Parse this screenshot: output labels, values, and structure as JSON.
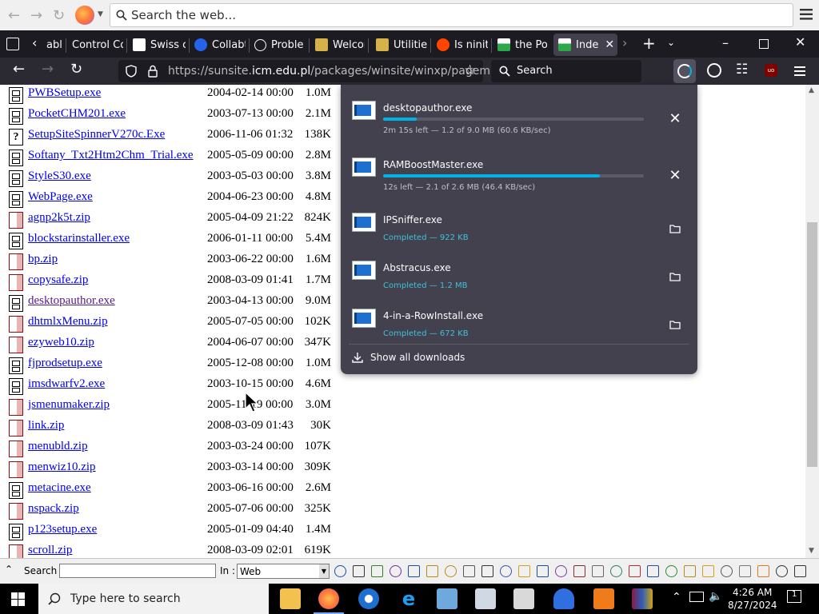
{
  "top_search": {
    "placeholder": "Search the web..."
  },
  "tabs": [
    {
      "label": "abl"
    },
    {
      "label": "Control Col"
    },
    {
      "label": "Swiss c"
    },
    {
      "label": "Collabt"
    },
    {
      "label": "Probler"
    },
    {
      "label": "Welcor"
    },
    {
      "label": "Utilitie:"
    },
    {
      "label": "Is ninite"
    },
    {
      "label": "the Pol"
    },
    {
      "label": "Inde",
      "active": true
    }
  ],
  "toolbar": {
    "url_prefix": "https://sunsite.",
    "url_domain": "icm.edu.pl",
    "url_path": "/packages/winsite/winxp/pagemkr/",
    "search_label": "Search"
  },
  "listing": [
    {
      "name": "PWBSetup.exe",
      "date": "2004-02-14 00:00",
      "size": "1.0M",
      "type": "exe"
    },
    {
      "name": "PocketCHM201.exe",
      "date": "2003-07-13 00:00",
      "size": "2.1M",
      "type": "exe"
    },
    {
      "name": "SetupSiteSpinnerV270c.Exe",
      "date": "2006-11-06 01:32",
      "size": "138K",
      "type": "unk"
    },
    {
      "name": "Softany_Txt2Htm2Chm_Trial.exe",
      "date": "2005-05-09 00:00",
      "size": "2.8M",
      "type": "exe"
    },
    {
      "name": "StyleS30.exe",
      "date": "2003-05-03 00:00",
      "size": "3.8M",
      "type": "exe"
    },
    {
      "name": "WebPage.exe",
      "date": "2004-06-23 00:00",
      "size": "4.8M",
      "type": "exe"
    },
    {
      "name": "agnp2k5t.zip",
      "date": "2005-04-09 21:22",
      "size": "824K",
      "type": "zip"
    },
    {
      "name": "blockstarinstaller.exe",
      "date": "2006-01-11 00:00",
      "size": "5.4M",
      "type": "exe"
    },
    {
      "name": "bp.zip",
      "date": "2003-06-22 00:00",
      "size": "1.6M",
      "type": "zip"
    },
    {
      "name": "copysafe.zip",
      "date": "2008-03-09 01:41",
      "size": "1.7M",
      "type": "zip"
    },
    {
      "name": "desktopauthor.exe",
      "date": "2003-04-13 00:00",
      "size": "9.0M",
      "type": "exe",
      "visited": true
    },
    {
      "name": "dhtmlxMenu.zip",
      "date": "2005-07-05 00:00",
      "size": "102K",
      "type": "zip"
    },
    {
      "name": "ezyweb10.zip",
      "date": "2004-06-07 00:00",
      "size": "347K",
      "type": "zip"
    },
    {
      "name": "fjprodsetup.exe",
      "date": "2005-12-08 00:00",
      "size": "1.0M",
      "type": "exe"
    },
    {
      "name": "imsdwarfv2.exe",
      "date": "2003-10-15 00:00",
      "size": "4.6M",
      "type": "exe"
    },
    {
      "name": "jsmenumaker.zip",
      "date": "2005-11-19 00:00",
      "size": "3.0M",
      "type": "zip"
    },
    {
      "name": "link.zip",
      "date": "2008-03-09 01:43",
      "size": "30K",
      "type": "zip"
    },
    {
      "name": "menubld.zip",
      "date": "2003-03-24 00:00",
      "size": "107K",
      "type": "zip"
    },
    {
      "name": "menwiz10.zip",
      "date": "2003-03-14 00:00",
      "size": "309K",
      "type": "zip"
    },
    {
      "name": "metacine.exe",
      "date": "2003-06-16 00:00",
      "size": "2.6M",
      "type": "exe"
    },
    {
      "name": "nspack.zip",
      "date": "2005-07-06 00:00",
      "size": "325K",
      "type": "zip"
    },
    {
      "name": "p123setup.exe",
      "date": "2005-01-09 04:40",
      "size": "1.4M",
      "type": "exe"
    },
    {
      "name": "scroll.zip",
      "date": "2008-03-09 02:01",
      "size": "619K",
      "type": "zip"
    }
  ],
  "downloads": {
    "items": [
      {
        "name": "desktopauthor.exe",
        "status": "2m 15s left — 1.2 of 9.0 MB (60.6 KB/sec)",
        "progress": 0.13,
        "done": false
      },
      {
        "name": "RAMBoostMaster.exe",
        "status": "12s left — 2.1 of 2.6 MB (46.4 KB/sec)",
        "progress": 0.83,
        "done": false
      },
      {
        "name": "IPSniffer.exe",
        "status": "Completed — 922 KB",
        "done": true
      },
      {
        "name": "Abstracus.exe",
        "status": "Completed — 1.2 MB",
        "done": true
      },
      {
        "name": "4-in-a-RowInstall.exe",
        "status": "Completed — 672 KB",
        "done": true
      }
    ],
    "show_all": "Show all downloads"
  },
  "bottom_toolbar": {
    "search_label": "Search :",
    "in_label": "In :",
    "in_value": "Web"
  },
  "taskbar": {
    "search_placeholder": "Type here to search",
    "time": "4:26 AM",
    "date": "8/27/2024",
    "notification_count": "1"
  },
  "colors": {
    "tab_strip_bg": "#1c1b22",
    "toolbar_bg": "#2b2a33",
    "panel_bg": "#42414d",
    "progress_fill": "#00b3e6",
    "completed_text": "#41c0d8",
    "link": "#0000ee",
    "visited_link": "#551a8b"
  }
}
